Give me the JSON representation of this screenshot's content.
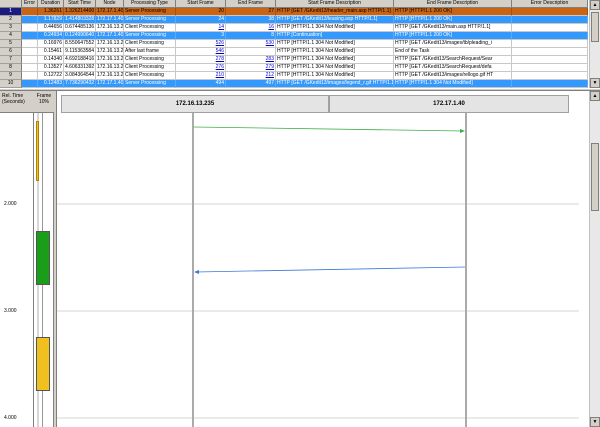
{
  "grid": {
    "headers": [
      "",
      "Error",
      "Duration",
      "Start Time",
      "Node",
      "Processing Type",
      "Start Frame",
      "End Frame",
      "Start Frame Description",
      "End Frame Description",
      "Error Description"
    ],
    "rows": [
      {
        "num": "1",
        "error": "",
        "duration": "1.36261",
        "start": "1.326214400",
        "node": "172.17.1.40",
        "type": "Server Processing",
        "sframe": "20",
        "eframe": "27",
        "sdesc": "HTTP [GET /GKedit13/header_main.asp HTTP/1.1]",
        "edesc": "HTTP [HTTP/1.1 200 OK]",
        "style": "sel"
      },
      {
        "num": "2",
        "error": "",
        "duration": "1.17829",
        "start": "1.414803328",
        "node": "172.17.1.40",
        "type": "Server Processing",
        "sframe": "24",
        "eframe": "38",
        "sdesc": "HTTP [GET /GKedit13/leasing.asp HTTP/1.1]",
        "edesc": "HTTP [HTTP/1.1 200 OK]",
        "style": "blue"
      },
      {
        "num": "3",
        "error": "",
        "duration": "0.44656",
        "start": "0.674485136",
        "node": "172.16.13.235",
        "type": "Client Processing",
        "sframe": "14",
        "eframe": "16",
        "sdesc": "HTTP [HTTP/1.1 304 Not Modified]",
        "edesc": "HTTP [GET /GKedit13/main.asp HTTP/1.1]",
        "style": ""
      },
      {
        "num": "4",
        "error": "",
        "duration": "0.24934",
        "start": "0.124990640",
        "node": "172.17.1.40",
        "type": "Server Processing",
        "sframe": "3",
        "eframe": "8",
        "sdesc": "HTTP [Continuation]",
        "edesc": "HTTP [HTTP/1.1 200 OK]",
        "style": "blue"
      },
      {
        "num": "5",
        "error": "",
        "duration": "0.16976",
        "start": "8.550647552",
        "node": "172.16.13.235",
        "type": "Client Processing",
        "sframe": "526",
        "eframe": "530",
        "sdesc": "HTTP [HTTP/1.1 304 Not Modified]",
        "edesc": "HTTP [GET /GKedit13/images/tb/pleading_i",
        "style": ""
      },
      {
        "num": "6",
        "error": "",
        "duration": "0.15461",
        "start": "9.115363584",
        "node": "172.16.13.235",
        "type": "After last frame",
        "sframe": "546",
        "eframe": "",
        "sdesc": "HTTP [HTTP/1.1 304 Not Modified]",
        "edesc": "End of the Task",
        "style": ""
      },
      {
        "num": "7",
        "error": "",
        "duration": "0.14340",
        "start": "4.692188416",
        "node": "172.16.13.235",
        "type": "Client Processing",
        "sframe": "278",
        "eframe": "283",
        "sdesc": "HTTP [HTTP/1.1 304 Not Modified]",
        "edesc": "HTTP [GET /GKedit13/SearchRequest/Sear",
        "style": ""
      },
      {
        "num": "8",
        "error": "",
        "duration": "0.13527",
        "start": "4.606331392",
        "node": "172.16.13.235",
        "type": "Client Processing",
        "sframe": "276",
        "eframe": "279",
        "sdesc": "HTTP [HTTP/1.1 304 Not Modified]",
        "edesc": "HTTP [GET /GKedit13/SearchRequest/defa",
        "style": ""
      },
      {
        "num": "9",
        "error": "",
        "duration": "0.12722",
        "start": "3.084364544",
        "node": "172.16.13.235",
        "type": "Client Processing",
        "sframe": "210",
        "eframe": "212",
        "sdesc": "HTTP [HTTP/1.1 304 Not Modified]",
        "edesc": "HTTP [GET /GKedit13/images/rellogo.gif HT",
        "style": ""
      },
      {
        "num": "10",
        "error": "",
        "duration": "0.12483",
        "start": "7.736290432",
        "node": "172.17.1.40",
        "type": "Server Processing",
        "sframe": "494",
        "eframe": "497",
        "sdesc": "HTTP [GET /GKedit13/images/legend_r.gif HTTP/1.1]",
        "edesc": "HTTP [HTTP/1.1 304 Not Modified]",
        "style": "blue"
      }
    ]
  },
  "timeline": {
    "header": "Rel. Time (Seconds)",
    "frame_header": "Frame",
    "frame_pct": "10%",
    "ticks": [
      "2.000",
      "3.000",
      "4.000"
    ]
  },
  "diagram": {
    "node_left": "172.16.13.235",
    "node_right": "172.17.1.40",
    "arrows": [
      {
        "from": "left",
        "to": "right",
        "color": "#3cb043"
      },
      {
        "from": "right",
        "to": "left",
        "color": "#3c78d8"
      }
    ]
  },
  "colors": {
    "selected_row": "#c86414",
    "highlight_row": "#3399ff",
    "bar_green": "#1a9e1a",
    "bar_yellow": "#f0c020"
  }
}
